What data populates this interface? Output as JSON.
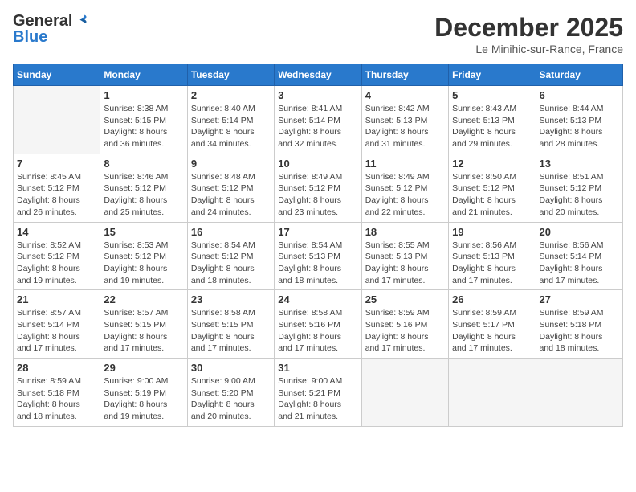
{
  "logo": {
    "general": "General",
    "blue": "Blue"
  },
  "title": "December 2025",
  "location": "Le Minihic-sur-Rance, France",
  "weekdays": [
    "Sunday",
    "Monday",
    "Tuesday",
    "Wednesday",
    "Thursday",
    "Friday",
    "Saturday"
  ],
  "weeks": [
    [
      {
        "day": "",
        "info": ""
      },
      {
        "day": "1",
        "info": "Sunrise: 8:38 AM\nSunset: 5:15 PM\nDaylight: 8 hours\nand 36 minutes."
      },
      {
        "day": "2",
        "info": "Sunrise: 8:40 AM\nSunset: 5:14 PM\nDaylight: 8 hours\nand 34 minutes."
      },
      {
        "day": "3",
        "info": "Sunrise: 8:41 AM\nSunset: 5:14 PM\nDaylight: 8 hours\nand 32 minutes."
      },
      {
        "day": "4",
        "info": "Sunrise: 8:42 AM\nSunset: 5:13 PM\nDaylight: 8 hours\nand 31 minutes."
      },
      {
        "day": "5",
        "info": "Sunrise: 8:43 AM\nSunset: 5:13 PM\nDaylight: 8 hours\nand 29 minutes."
      },
      {
        "day": "6",
        "info": "Sunrise: 8:44 AM\nSunset: 5:13 PM\nDaylight: 8 hours\nand 28 minutes."
      }
    ],
    [
      {
        "day": "7",
        "info": "Sunrise: 8:45 AM\nSunset: 5:12 PM\nDaylight: 8 hours\nand 26 minutes."
      },
      {
        "day": "8",
        "info": "Sunrise: 8:46 AM\nSunset: 5:12 PM\nDaylight: 8 hours\nand 25 minutes."
      },
      {
        "day": "9",
        "info": "Sunrise: 8:48 AM\nSunset: 5:12 PM\nDaylight: 8 hours\nand 24 minutes."
      },
      {
        "day": "10",
        "info": "Sunrise: 8:49 AM\nSunset: 5:12 PM\nDaylight: 8 hours\nand 23 minutes."
      },
      {
        "day": "11",
        "info": "Sunrise: 8:49 AM\nSunset: 5:12 PM\nDaylight: 8 hours\nand 22 minutes."
      },
      {
        "day": "12",
        "info": "Sunrise: 8:50 AM\nSunset: 5:12 PM\nDaylight: 8 hours\nand 21 minutes."
      },
      {
        "day": "13",
        "info": "Sunrise: 8:51 AM\nSunset: 5:12 PM\nDaylight: 8 hours\nand 20 minutes."
      }
    ],
    [
      {
        "day": "14",
        "info": "Sunrise: 8:52 AM\nSunset: 5:12 PM\nDaylight: 8 hours\nand 19 minutes."
      },
      {
        "day": "15",
        "info": "Sunrise: 8:53 AM\nSunset: 5:12 PM\nDaylight: 8 hours\nand 19 minutes."
      },
      {
        "day": "16",
        "info": "Sunrise: 8:54 AM\nSunset: 5:12 PM\nDaylight: 8 hours\nand 18 minutes."
      },
      {
        "day": "17",
        "info": "Sunrise: 8:54 AM\nSunset: 5:13 PM\nDaylight: 8 hours\nand 18 minutes."
      },
      {
        "day": "18",
        "info": "Sunrise: 8:55 AM\nSunset: 5:13 PM\nDaylight: 8 hours\nand 17 minutes."
      },
      {
        "day": "19",
        "info": "Sunrise: 8:56 AM\nSunset: 5:13 PM\nDaylight: 8 hours\nand 17 minutes."
      },
      {
        "day": "20",
        "info": "Sunrise: 8:56 AM\nSunset: 5:14 PM\nDaylight: 8 hours\nand 17 minutes."
      }
    ],
    [
      {
        "day": "21",
        "info": "Sunrise: 8:57 AM\nSunset: 5:14 PM\nDaylight: 8 hours\nand 17 minutes."
      },
      {
        "day": "22",
        "info": "Sunrise: 8:57 AM\nSunset: 5:15 PM\nDaylight: 8 hours\nand 17 minutes."
      },
      {
        "day": "23",
        "info": "Sunrise: 8:58 AM\nSunset: 5:15 PM\nDaylight: 8 hours\nand 17 minutes."
      },
      {
        "day": "24",
        "info": "Sunrise: 8:58 AM\nSunset: 5:16 PM\nDaylight: 8 hours\nand 17 minutes."
      },
      {
        "day": "25",
        "info": "Sunrise: 8:59 AM\nSunset: 5:16 PM\nDaylight: 8 hours\nand 17 minutes."
      },
      {
        "day": "26",
        "info": "Sunrise: 8:59 AM\nSunset: 5:17 PM\nDaylight: 8 hours\nand 17 minutes."
      },
      {
        "day": "27",
        "info": "Sunrise: 8:59 AM\nSunset: 5:18 PM\nDaylight: 8 hours\nand 18 minutes."
      }
    ],
    [
      {
        "day": "28",
        "info": "Sunrise: 8:59 AM\nSunset: 5:18 PM\nDaylight: 8 hours\nand 18 minutes."
      },
      {
        "day": "29",
        "info": "Sunrise: 9:00 AM\nSunset: 5:19 PM\nDaylight: 8 hours\nand 19 minutes."
      },
      {
        "day": "30",
        "info": "Sunrise: 9:00 AM\nSunset: 5:20 PM\nDaylight: 8 hours\nand 20 minutes."
      },
      {
        "day": "31",
        "info": "Sunrise: 9:00 AM\nSunset: 5:21 PM\nDaylight: 8 hours\nand 21 minutes."
      },
      {
        "day": "",
        "info": ""
      },
      {
        "day": "",
        "info": ""
      },
      {
        "day": "",
        "info": ""
      }
    ]
  ]
}
